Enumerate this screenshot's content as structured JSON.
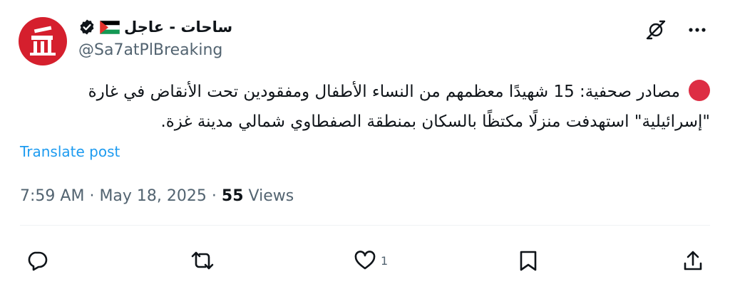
{
  "header": {
    "display_name": "ساحات - عاجل",
    "handle": "@Sa7atPlBreaking"
  },
  "icons": {
    "avatar": "sa7at-logo",
    "flag": "palestine-flag",
    "verified": "verified-badge-icon",
    "grok": "grok-icon",
    "more": "more-icon",
    "reply": "reply-icon",
    "repost": "repost-icon",
    "like": "heart-icon",
    "bookmark": "bookmark-icon",
    "share": "share-icon"
  },
  "tweet": {
    "text": "مصادر صحفية: 15 شهيدًا معظمهم من النساء الأطفال ومفقودين تحت الأنقاض في غارة \"إسرائيلية\" استهدفت منزلًا مكتظًا بالسكان بمنطقة الصفطاوي شمالي مدينة غزة.",
    "translate_label": "Translate post",
    "time": "7:59 AM",
    "date": "May 18, 2025",
    "separator": "·",
    "views_count": "55",
    "views_label": "Views"
  },
  "actions": {
    "like_count": "1"
  },
  "colors": {
    "brand_red": "#d51f2d",
    "link_blue": "#1d9bf0",
    "muted_gray": "#536471",
    "text": "#0f1419"
  }
}
